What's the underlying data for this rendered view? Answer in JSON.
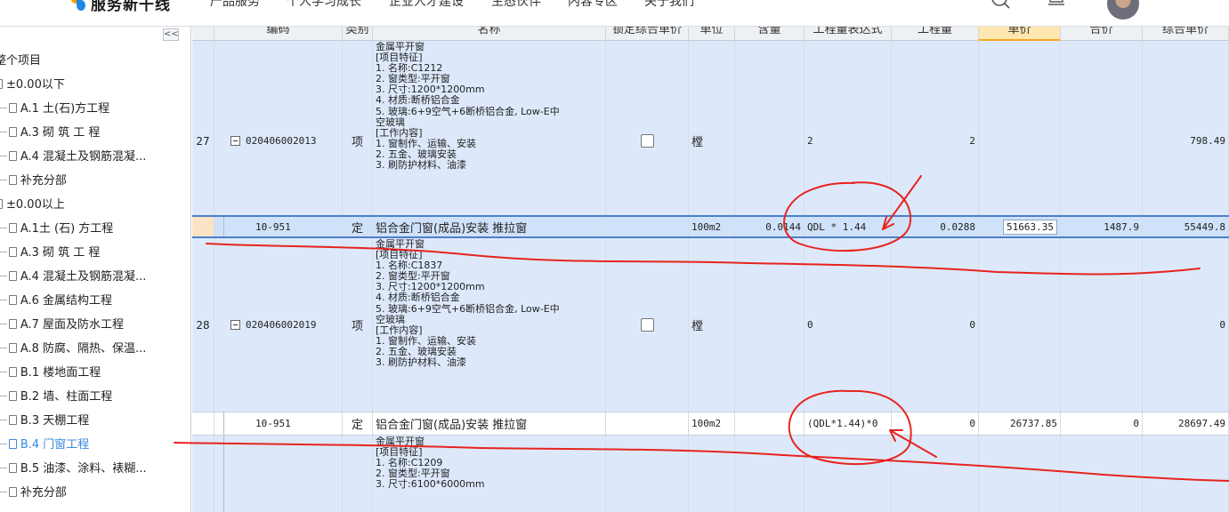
{
  "nav": {
    "logo_text": "服务新干线",
    "links": [
      "产品服务",
      "个人学习成长",
      "企业人才建设",
      "生态伙伴",
      "内容专区",
      "关于我们"
    ]
  },
  "sidebar": {
    "collapse_label": "<<",
    "items": [
      {
        "label": "整个项目",
        "level": 0,
        "type": "folder"
      },
      {
        "label": "±0.00以下",
        "level": 0,
        "type": "file"
      },
      {
        "label": "A.1 土(石)方工程",
        "level": 1,
        "type": "file"
      },
      {
        "label": "A.3 砌 筑 工 程",
        "level": 1,
        "type": "file"
      },
      {
        "label": "A.4 混凝土及钢筋混凝...",
        "level": 1,
        "type": "file"
      },
      {
        "label": "补充分部",
        "level": 1,
        "type": "file"
      },
      {
        "label": "±0.00以上",
        "level": 0,
        "type": "file"
      },
      {
        "label": "A.1土 (石) 方工程",
        "level": 1,
        "type": "file"
      },
      {
        "label": "A.3 砌 筑 工 程",
        "level": 1,
        "type": "file"
      },
      {
        "label": "A.4 混凝土及钢筋混凝...",
        "level": 1,
        "type": "file"
      },
      {
        "label": "A.6 金属结构工程",
        "level": 1,
        "type": "file"
      },
      {
        "label": "A.7 屋面及防水工程",
        "level": 1,
        "type": "file"
      },
      {
        "label": "A.8 防腐、隔热、保温...",
        "level": 1,
        "type": "file"
      },
      {
        "label": "B.1 楼地面工程",
        "level": 1,
        "type": "file"
      },
      {
        "label": "B.2 墙、柱面工程",
        "level": 1,
        "type": "file"
      },
      {
        "label": "B.3 天棚工程",
        "level": 1,
        "type": "file"
      },
      {
        "label": "B.4 门窗工程",
        "level": 1,
        "type": "file",
        "active": true
      },
      {
        "label": "B.5 油漆、涂料、裱糊...",
        "level": 1,
        "type": "file"
      },
      {
        "label": "补充分部",
        "level": 1,
        "type": "file"
      }
    ]
  },
  "table": {
    "headers": [
      "",
      "编码",
      "类别",
      "名称",
      "锁定综合单价",
      "单位",
      "含量",
      "工程量表达式",
      "工程量",
      "单价",
      "合价",
      "综合单价"
    ],
    "row27": {
      "num": "27",
      "code": "020406002013",
      "type": "项",
      "feature": [
        "金属平开窗",
        "[项目特征]",
        "1. 名称:C1212",
        "2. 窗类型:平开窗",
        "3. 尺寸:1200*1200mm",
        "4. 材质:断桥铝合金",
        "5. 玻璃:6+9空气+6断桥铝合金, Low-E中",
        "空玻璃",
        "[工作内容]",
        "1. 窗制作、运输、安装",
        "2. 五金、玻璃安装",
        "3. 刷防护材料、油漆"
      ],
      "unit": "樘",
      "expr": "2",
      "qty": "2",
      "composite": "798.49"
    },
    "quota1": {
      "code": "10-951",
      "type": "定",
      "name": "铝合金门窗(成品)安装 推拉窗",
      "unit": "100m2",
      "content": "0.0144",
      "expr": "QDL * 1.44",
      "qty": "0.0288",
      "price": "51663.35",
      "total": "1487.9",
      "composite": "55449.8"
    },
    "row28": {
      "num": "28",
      "code": "020406002019",
      "type": "项",
      "feature": [
        "金属平开窗",
        "[项目特征]",
        "1. 名称:C1837",
        "2. 窗类型:平开窗",
        "3. 尺寸:1200*1200mm",
        "4. 材质:断桥铝合金",
        "5. 玻璃:6+9空气+6断桥铝合金, Low-E中",
        "空玻璃",
        "[工作内容]",
        "1. 窗制作、运输、安装",
        "2. 五金、玻璃安装",
        "3. 刷防护材料、油漆"
      ],
      "unit": "樘",
      "expr": "0",
      "qty": "0",
      "composite": "0"
    },
    "quota2": {
      "code": "10-951",
      "type": "定",
      "name": "铝合金门窗(成品)安装 推拉窗",
      "unit": "100m2",
      "expr": "(QDL*1.44)*0",
      "qty": "0",
      "price": "26737.85",
      "total": "0",
      "composite": "28697.49"
    },
    "row29": {
      "feature": [
        "金属平开窗",
        "[项目特征]",
        "1. 名称:C1209",
        "2. 窗类型:平开窗",
        "3. 尺寸:6100*6000mm"
      ]
    }
  },
  "colors": {
    "annotation": "#e8231e",
    "selected_row": "#d0e2fa",
    "item_row": "#dde9fb",
    "active_link": "#3c8ae0"
  }
}
